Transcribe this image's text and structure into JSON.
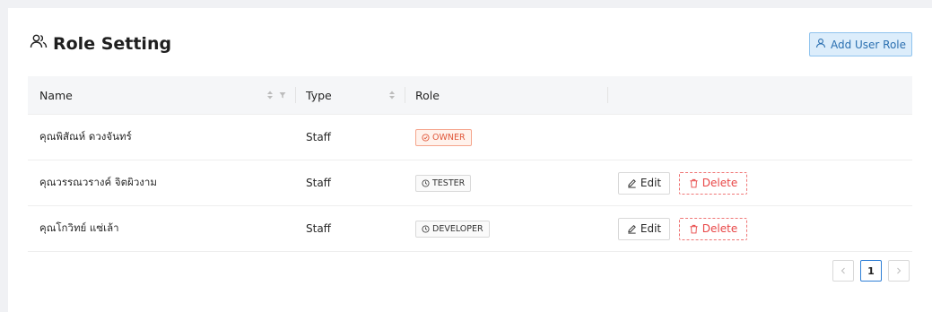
{
  "header": {
    "title": "Role Setting",
    "title_icon": "users-icon",
    "add_button_label": "Add User Role",
    "add_button_icon": "user-icon"
  },
  "table": {
    "columns": [
      "Name",
      "Type",
      "Role",
      ""
    ],
    "rows": [
      {
        "name": "คุณพิสัณห์ ดวงจันทร์",
        "type": "Staff",
        "role": "OWNER",
        "role_style": "owner",
        "actions": false
      },
      {
        "name": "คุณวรรณวรางค์ จิตผิวงาม",
        "type": "Staff",
        "role": "TESTER",
        "role_style": "default",
        "actions": true
      },
      {
        "name": "คุณโกวิทย์ แซ่เล้า",
        "type": "Staff",
        "role": "DEVELOPER",
        "role_style": "default",
        "actions": true
      }
    ],
    "edit_label": "Edit",
    "delete_label": "Delete"
  },
  "pagination": {
    "current_page": "1"
  },
  "colors": {
    "accent": "#2f7fd6",
    "owner_tag": "#e0573a",
    "delete": "#e84545"
  }
}
